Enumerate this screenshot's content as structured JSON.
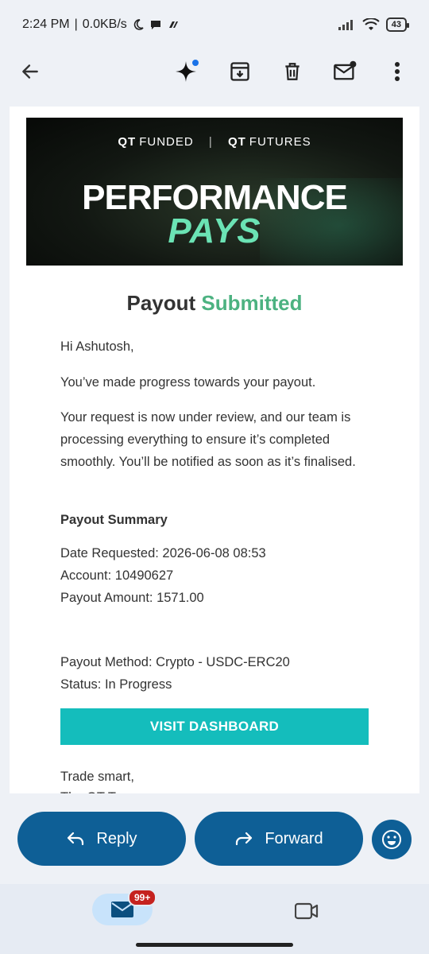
{
  "status_bar": {
    "time": "2:24 PM",
    "network_speed": "0.0KB/s",
    "battery": "43"
  },
  "app_bar": {
    "icons": [
      "back-arrow-icon",
      "gemini-sparkle-icon",
      "archive-icon",
      "delete-icon",
      "mark-unread-icon",
      "more-vert-icon"
    ]
  },
  "email": {
    "banner": {
      "brand1_bold": "QT",
      "brand1": "FUNDED",
      "separator": "|",
      "brand2_bold": "QT",
      "brand2": "FUTURES",
      "headline": "PERFORMANCE",
      "headline_accent": "PAYS"
    },
    "title": "Payout",
    "title_accent": "Submitted",
    "greeting": "Hi Ashutosh,",
    "para1": "You’ve made progress towards your payout.",
    "para2": "Your request is now under review, and our team is processing everything to ensure it’s completed smoothly. You’ll be notified as soon as it’s finalised.",
    "summary_heading": "Payout Summary",
    "date_requested": "Date Requested: 2026-06-08 08:53",
    "account": "Account: 10490627",
    "amount": "Payout Amount: 1571.00",
    "method": "Payout Method: Crypto - USDC-ERC20",
    "status": "Status: In Progress",
    "button_label": "VISIT DASHBOARD",
    "signoff": "Trade smart,",
    "signoff2": "The QT Team"
  },
  "actions": {
    "reply_label": "Reply",
    "forward_label": "Forward"
  },
  "bottom_nav": {
    "mail_badge": "99+"
  },
  "colors": {
    "accent_green": "#4cb281",
    "button_teal": "#14bdbc",
    "action_blue": "#0e5f96"
  }
}
